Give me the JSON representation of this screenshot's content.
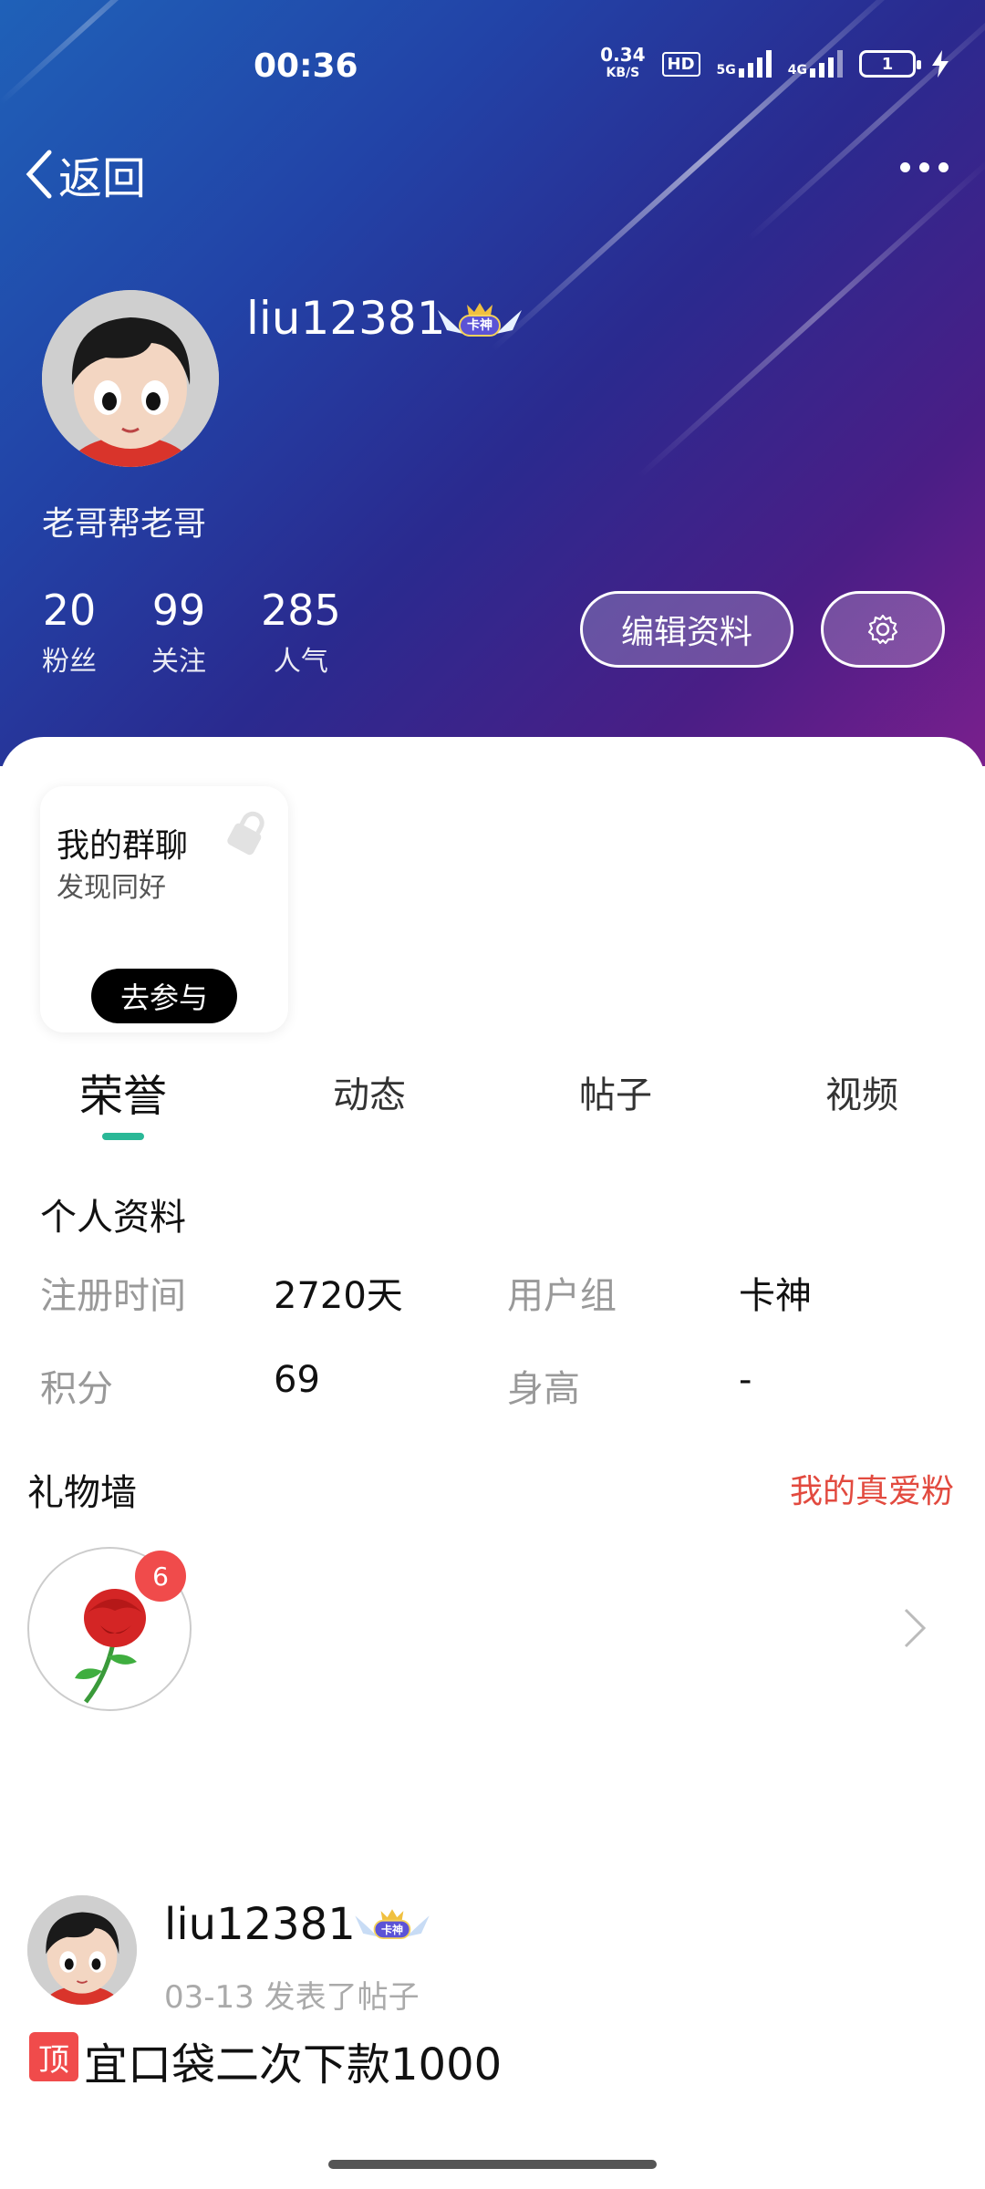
{
  "status_bar": {
    "time": "00:36",
    "net_speed_value": "0.34",
    "net_speed_unit": "KB/S",
    "hd_label": "HD",
    "signal_1_label": "5G",
    "signal_2_label": "4G",
    "battery_label": "1"
  },
  "topbar": {
    "back_label": "返回"
  },
  "profile": {
    "username": "liu12381",
    "badge_label": "卡神",
    "signature": "老哥帮老哥",
    "stats": [
      {
        "value": "20",
        "label": "粉丝"
      },
      {
        "value": "99",
        "label": "关注"
      },
      {
        "value": "285",
        "label": "人气"
      }
    ],
    "edit_button": "编辑资料"
  },
  "group_card": {
    "title": "我的群聊",
    "subtitle": "发现同好",
    "button": "去参与"
  },
  "tabs": [
    {
      "label": "荣誉",
      "active": true
    },
    {
      "label": "动态",
      "active": false
    },
    {
      "label": "帖子",
      "active": false
    },
    {
      "label": "视频",
      "active": false
    }
  ],
  "personal_info": {
    "title": "个人资料",
    "rows": [
      {
        "label1": "注册时间",
        "value1": "2720天",
        "label2": "用户组",
        "value2": "卡神"
      },
      {
        "label1": "积分",
        "value1": "69",
        "label2": "身高",
        "value2": "-"
      }
    ]
  },
  "gift_wall": {
    "title": "礼物墙",
    "link": "我的真爱粉",
    "gift_icon": "rose-icon",
    "count": "6"
  },
  "post": {
    "username": "liu12381",
    "badge_label": "卡神",
    "meta": "03-13 发表了帖子",
    "pin_label": "顶",
    "title": "宜口袋二次下款1000"
  },
  "colors": {
    "accent_tab": "#2ab897",
    "link_red": "#e24a3f",
    "badge_red": "#f04b4b"
  }
}
